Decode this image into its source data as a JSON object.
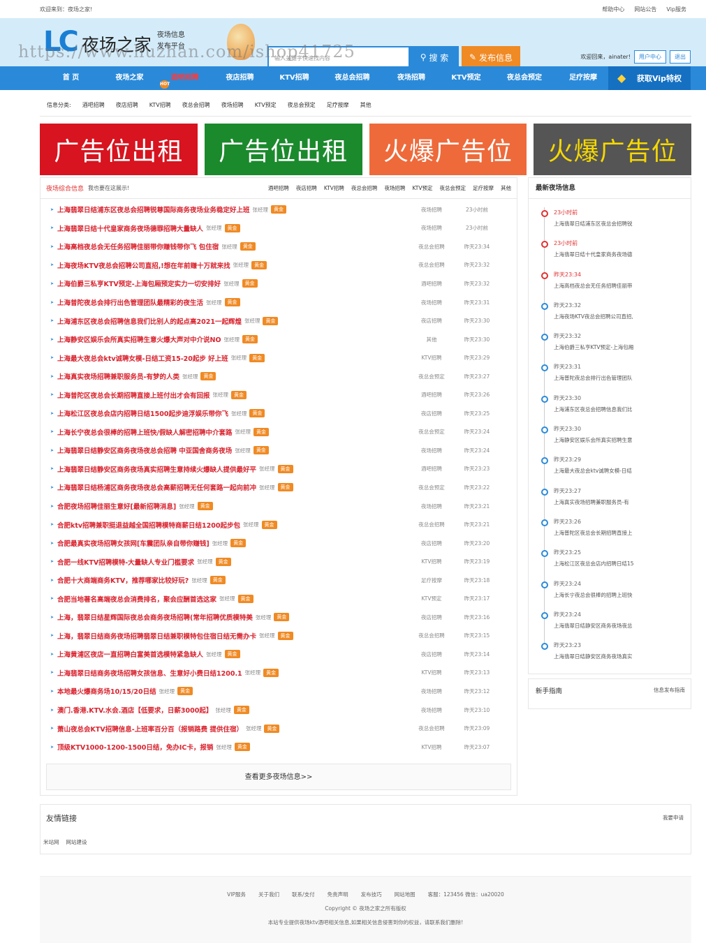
{
  "topbar": {
    "welcome": "欢迎来到：夜场之家!",
    "links": [
      "帮助中心",
      "网站公告",
      "Vip服务"
    ]
  },
  "header": {
    "logo_letters": "LC",
    "site_name": "夜场之家",
    "slogan_1": "夜场信息",
    "slogan_2": "发布平台",
    "watermark": "https://www.huzhan.com/ishop41725",
    "search_placeholder": "输入关键字快速找内容",
    "search_button": "搜 索",
    "post_button": "发布信息",
    "user_greeting": "欢迎回来，ainater!",
    "user_center": "用户中心",
    "logout": "退出"
  },
  "nav": {
    "items": [
      "首 页",
      "夜场之家",
      "酒吧招聘",
      "夜店招聘",
      "KTV招聘",
      "夜总会招聘",
      "夜场招聘",
      "KTV预定",
      "夜总会预定",
      "足疗按摩"
    ],
    "active_index": 2,
    "hot_badge": "HOT",
    "vip_label": "获取Vip特权"
  },
  "categories": {
    "label": "信息分类:",
    "items": [
      "酒吧招聘",
      "夜店招聘",
      "KTV招聘",
      "夜总会招聘",
      "夜场招聘",
      "KTV预定",
      "夜总会预定",
      "足疗按摩",
      "其他"
    ]
  },
  "banners": [
    {
      "text": "广告位出租",
      "color": "#d7141f"
    },
    {
      "text": "广告位出租",
      "color": "#1b8a2d"
    },
    {
      "text": "火爆广告位",
      "color": "#ee6a3a"
    },
    {
      "text": "火爆广告位",
      "color": "#555555",
      "text_color": "#f5d800"
    }
  ],
  "main": {
    "title": "夜场综合信息",
    "subtitle": "我也要在这展示!",
    "tabs": [
      "酒吧招聘",
      "夜店招聘",
      "KTV招聘",
      "夜总会招聘",
      "夜场招聘",
      "KTV预定",
      "夜总会预定",
      "足疗按摩",
      "其他"
    ],
    "badge_text": "黄金",
    "rows": [
      {
        "title": "上海翡翠日结浦东区夜总会招聘锐尊国际商务夜场业务稳定好上班",
        "author": "张经理",
        "cat": "夜场招聘",
        "time": "23小时前"
      },
      {
        "title": "上海翡翠日结十代皇家商务夜场德罪招聘大量缺人",
        "author": "张经理",
        "cat": "夜场招聘",
        "time": "23小时前"
      },
      {
        "title": "上海高档夜总会无任务招聘佳丽带你赚钱带你飞 包住宿",
        "author": "张经理",
        "cat": "夜总会招聘",
        "time": "昨天23:34"
      },
      {
        "title": "上海夜场KTV夜总会招聘公司直招,!想在年前赚十万就来找",
        "author": "张经理",
        "cat": "夜总会招聘",
        "time": "昨天23:32"
      },
      {
        "title": "上海伯爵三私亨KTV预定-上海包厢预定实力一切安排好",
        "author": "张经理",
        "cat": "酒吧招聘",
        "time": "昨天23:32"
      },
      {
        "title": "上海普陀夜总会排行出色管理团队最精彩的夜生活",
        "author": "张经理",
        "cat": "夜场招聘",
        "time": "昨天23:31"
      },
      {
        "title": "上海浦东区夜总会招聘信息我们比别人的起点高2021一起辉煌",
        "author": "张经理",
        "cat": "夜店招聘",
        "time": "昨天23:30"
      },
      {
        "title": "上海静安区娱乐会所真实招聘生意火爆大声对中介说NO",
        "author": "张经理",
        "cat": "其他",
        "time": "昨天23:30"
      },
      {
        "title": "上海最大夜总会ktv诚聘女模-日结工资15-20起步 好上班",
        "author": "张经理",
        "cat": "KTV招聘",
        "time": "昨天23:29"
      },
      {
        "title": "上海真实夜场招聘兼职服务员-有梦的人类",
        "author": "张经理",
        "cat": "夜总会预定",
        "time": "昨天23:27"
      },
      {
        "title": "上海普陀区夜总会长期招聘直接上班付出才会有回报",
        "author": "张经理",
        "cat": "酒吧招聘",
        "time": "昨天23:26"
      },
      {
        "title": "上海松江区夜总会店内招聘日结1500起步迪浮娱乐带你飞",
        "author": "张经理",
        "cat": "夜店招聘",
        "time": "昨天23:25"
      },
      {
        "title": "上海长宁夜总会很棒的招聘上班快/假缺人解密招聘中介套路",
        "author": "张经理",
        "cat": "夜总会预定",
        "time": "昨天23:24"
      },
      {
        "title": "上海翡翠日结静安区商务夜场夜总会招聘 中亚国舍商务夜场",
        "author": "张经理",
        "cat": "夜场招聘",
        "time": "昨天23:24"
      },
      {
        "title": "上海翡翠日结静安区商务夜场真实招聘生意持续火爆缺人提供最好平",
        "author": "张经理",
        "cat": "酒吧招聘",
        "time": "昨天23:23"
      },
      {
        "title": "上海翡翠日结杨浦区商务夜场夜总会高薪招聘无任何套路一起向前冲",
        "author": "张经理",
        "cat": "夜总会预定",
        "time": "昨天23:22"
      },
      {
        "title": "合肥夜场招聘佳丽生意好[最新招聘消息]",
        "author": "张经理",
        "cat": "夜场招聘",
        "time": "昨天23:21"
      },
      {
        "title": "合肥ktv招聘兼职挺退益越全国招聘模特商薪日结1200起步包",
        "author": "张经理",
        "cat": "夜总会招聘",
        "time": "昨天23:21"
      },
      {
        "title": "合肥最真实夜场招聘女孩网[车震团队亲自带你赚钱]",
        "author": "张经理",
        "cat": "夜店招聘",
        "time": "昨天23:20"
      },
      {
        "title": "合肥一线KTV招聘模特-大量缺人专业门槛要求",
        "author": "张经理",
        "cat": "KTV招聘",
        "time": "昨天23:19"
      },
      {
        "title": "合肥十大商端商务KTV，推荐哪家比较好玩?",
        "author": "张经理",
        "cat": "足疗按摩",
        "time": "昨天23:18"
      },
      {
        "title": "合肥当地著名高端夜总会消费排名，聚会应酬首选这家",
        "author": "张经理",
        "cat": "KTV预定",
        "time": "昨天23:17"
      },
      {
        "title": "上海，翡翠日结星辉国际夜总会商务夜场招聘(常年招聘优质模特美",
        "author": "张经理",
        "cat": "夜店招聘",
        "time": "昨天23:16"
      },
      {
        "title": "上海，翡翠日结商务夜场招聘翡翠日结兼职模特包住宿日结无需办卡",
        "author": "张经理",
        "cat": "夜总会招聘",
        "time": "昨天23:15"
      },
      {
        "title": "上海黄浦区夜店一直招聘白富美首选模特紧急缺人",
        "author": "张经理",
        "cat": "夜店招聘",
        "time": "昨天23:14"
      },
      {
        "title": "上海翡翠日结商务夜场招聘女孩信息、生意好小费日结1200.1",
        "author": "张经理",
        "cat": "KTV招聘",
        "time": "昨天23:13"
      },
      {
        "title": "本地最火爆商务场10/15/20日结",
        "author": "张经理",
        "cat": "夜场招聘",
        "time": "昨天23:12"
      },
      {
        "title": "澳门.香港.KTV.水会.酒店【低要求，日薪3000起】",
        "author": "张经理",
        "cat": "夜场招聘",
        "time": "昨天23:10"
      },
      {
        "title": "萧山夜总会KTV招聘信息-上班率百分百（报销路费 提供住宿）",
        "author": "张经理",
        "cat": "夜总会招聘",
        "time": "昨天23:09"
      },
      {
        "title": "顶级KTV1000-1200-1500日结，免办IC卡，报销",
        "author": "张经理",
        "cat": "KTV招聘",
        "time": "昨天23:07"
      }
    ],
    "more": "查看更多夜场信息>>"
  },
  "sidebar": {
    "title": "最新夜场信息",
    "items": [
      {
        "time": "23小时前",
        "desc": "上海翡翠日结浦东区夜总会招聘锐",
        "hot": true
      },
      {
        "time": "23小时前",
        "desc": "上海翡翠日结十代皇家商务夜场德",
        "hot": true
      },
      {
        "time": "昨天23:34",
        "desc": "上海高档夜总会无任务招聘佳丽带",
        "hot": true
      },
      {
        "time": "昨天23:32",
        "desc": "上海夜场KTV夜总会招聘公司直招,",
        "hot": false
      },
      {
        "time": "昨天23:32",
        "desc": "上海伯爵三私亨KTV预定-上海包厢",
        "hot": false
      },
      {
        "time": "昨天23:31",
        "desc": "上海普陀夜总会排行出色管理团队",
        "hot": false
      },
      {
        "time": "昨天23:30",
        "desc": "上海浦东区夜总会招聘信息我们比",
        "hot": false
      },
      {
        "time": "昨天23:30",
        "desc": "上海静安区娱乐会所真实招聘生意",
        "hot": false
      },
      {
        "time": "昨天23:29",
        "desc": "上海最大夜总会ktv诚聘女模-日结",
        "hot": false
      },
      {
        "time": "昨天23:27",
        "desc": "上海真实夜场招聘兼职服务员-有",
        "hot": false
      },
      {
        "time": "昨天23:26",
        "desc": "上海普陀区夜总会长期招聘直接上",
        "hot": false
      },
      {
        "time": "昨天23:25",
        "desc": "上海松江区夜总会店内招聘日结15",
        "hot": false
      },
      {
        "time": "昨天23:24",
        "desc": "上海长宁夜总会很棒的招聘上班快",
        "hot": false
      },
      {
        "time": "昨天23:24",
        "desc": "上海翡翠日结静安区商务夜场夜总",
        "hot": false
      },
      {
        "time": "昨天23:23",
        "desc": "上海翡翠日结静安区商务夜场真实",
        "hot": false
      }
    ]
  },
  "guide": {
    "title": "新手指南",
    "link": "信息发布指南"
  },
  "friends": {
    "title": "友情链接",
    "apply": "我要申请",
    "links": [
      "米站网",
      "网站建设"
    ]
  },
  "footer": {
    "links": [
      "VIP服务",
      "关于我们",
      "联系/支付",
      "免责声明",
      "发布技巧",
      "网站地图"
    ],
    "contact": "客服：123456 微信：ua20020",
    "copyright": "Copyright © 夜场之家之所有版权",
    "disclaimer": "本站专业提供夜场ktv酒吧相关信息,如果相关信息侵害到你的权益，请联系我们删除!"
  },
  "colors": {
    "accent": "#2a8ad9",
    "orange": "#f08a24",
    "red": "#d9232e"
  }
}
